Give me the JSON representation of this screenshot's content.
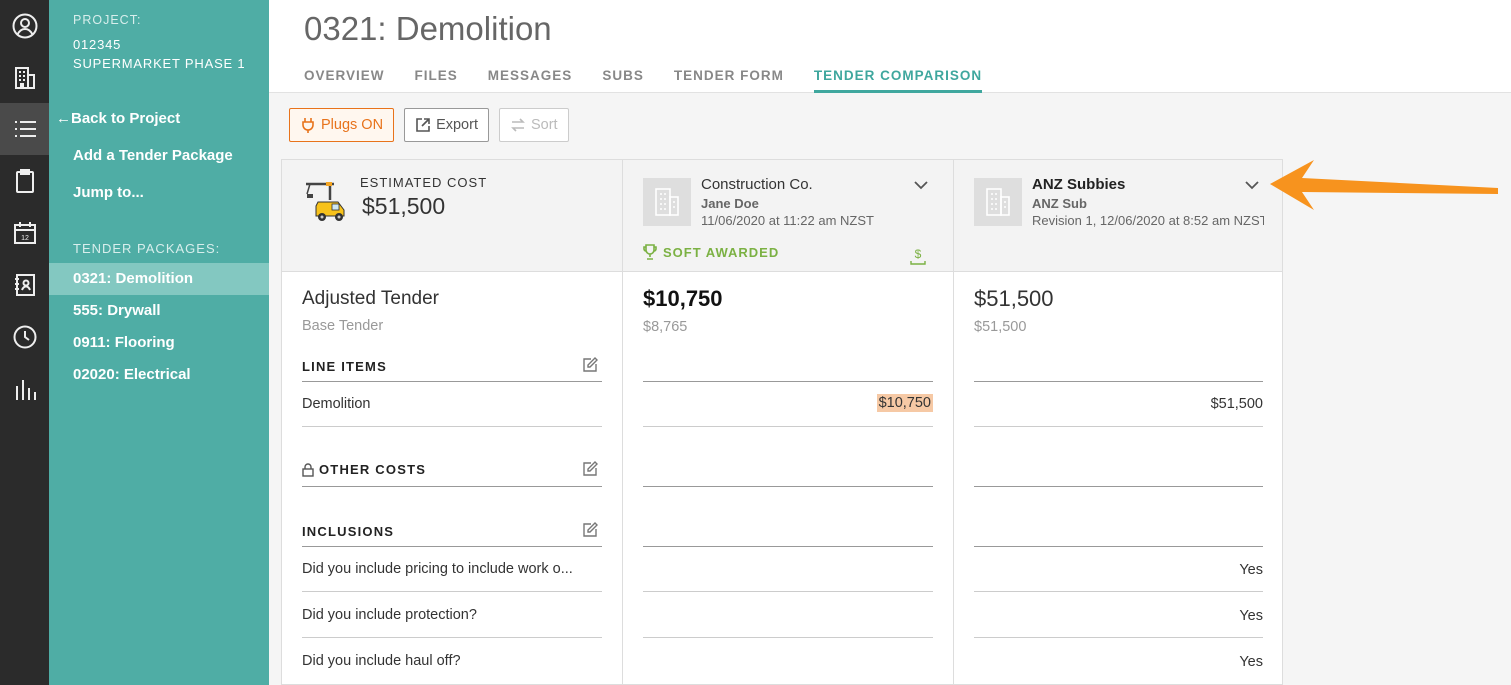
{
  "rail": {
    "icons": [
      "user-circle-icon",
      "building-icon",
      "list-icon",
      "clipboard-icon",
      "calendar-icon",
      "contacts-book-icon",
      "clock-icon",
      "bar-chart-icon"
    ],
    "calendar_day": "12"
  },
  "sidebar": {
    "project_label": "PROJECT:",
    "project_number": "012345",
    "project_name": "SUPERMARKET PHASE 1",
    "back_label": "Back to Project",
    "add_package": "Add a Tender Package",
    "jump_to": "Jump to...",
    "packages_label": "TENDER PACKAGES:",
    "packages": [
      {
        "label": "0321: Demolition",
        "selected": true
      },
      {
        "label": "555: Drywall",
        "selected": false
      },
      {
        "label": "0911: Flooring",
        "selected": false
      },
      {
        "label": "02020: Electrical",
        "selected": false
      }
    ]
  },
  "header": {
    "title": "0321: Demolition",
    "tabs": [
      {
        "label": "OVERVIEW"
      },
      {
        "label": "FILES"
      },
      {
        "label": "MESSAGES"
      },
      {
        "label": "SUBS"
      },
      {
        "label": "TENDER FORM"
      },
      {
        "label": "TENDER COMPARISON",
        "active": true
      }
    ]
  },
  "toolbar": {
    "plugs_label": "Plugs ON",
    "export_label": "Export",
    "sort_label": "Sort"
  },
  "estimate": {
    "label": "ESTIMATED COST",
    "value": "$51,500"
  },
  "bidders": [
    {
      "company": "Construction Co.",
      "person": "Jane Doe",
      "date": "11/06/2020 at 11:22 am NZST",
      "status": "SOFT AWARDED",
      "adjusted": "$10,750",
      "base": "$8,765",
      "line_demolition": "$10,750",
      "answers": [
        "",
        "",
        ""
      ]
    },
    {
      "company": "ANZ Subbies",
      "person": "ANZ Sub",
      "date": "Revision 1, 12/06/2020 at 8:52 am NZST",
      "adjusted": "$51,500",
      "base": "$51,500",
      "line_demolition": "$51,500",
      "answers": [
        "Yes",
        "Yes",
        "Yes"
      ]
    }
  ],
  "labels": {
    "adjusted": "Adjusted Tender",
    "base": "Base Tender",
    "line_items": "LINE ITEMS",
    "demolition": "Demolition",
    "other_costs": "OTHER COSTS",
    "inclusions": "INCLUSIONS",
    "questions": [
      "Did you include pricing to include work o...",
      "Did you include protection?",
      "Did you include haul off?"
    ]
  },
  "colors": {
    "teal": "#4fada5",
    "accent": "#3fa79e",
    "plugs_orange": "#e8731b",
    "award_green": "#7bb143",
    "arrow_orange": "#f7931e"
  }
}
